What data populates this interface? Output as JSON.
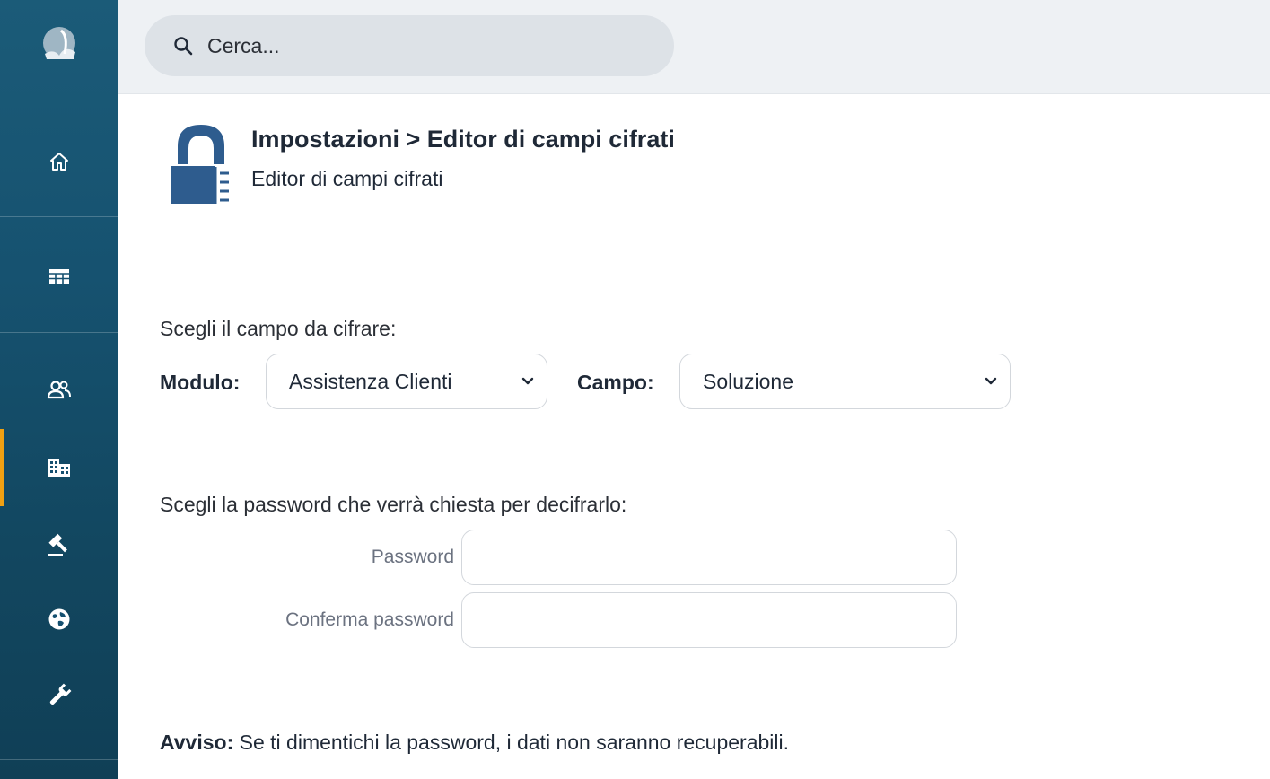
{
  "sidebar": {
    "items": [
      {
        "name": "logo"
      },
      {
        "name": "home"
      },
      {
        "name": "grid"
      },
      {
        "name": "contacts"
      },
      {
        "name": "organizations"
      },
      {
        "name": "legal"
      },
      {
        "name": "globe"
      },
      {
        "name": "tools"
      }
    ],
    "active_item": "organizations",
    "accent_color": "#f0a012"
  },
  "search": {
    "placeholder": "Cerca..."
  },
  "header": {
    "title": "Impostazioni > Editor di campi cifrati",
    "subtitle": "Editor di campi cifrati",
    "icon": "lock-icon"
  },
  "form": {
    "choose_field_label": "Scegli il campo da cifrare:",
    "module_label": "Modulo:",
    "module_value": "Assistenza Clienti",
    "field_label": "Campo:",
    "field_value": "Soluzione",
    "choose_password_label": "Scegli la password che verrà chiesta per decifrarlo:",
    "password_label": "Password",
    "confirm_password_label": "Conferma password"
  },
  "warning": {
    "prefix": "Avviso:",
    "text": " Se ti dimentichi la password, i dati non saranno recuperabili."
  }
}
